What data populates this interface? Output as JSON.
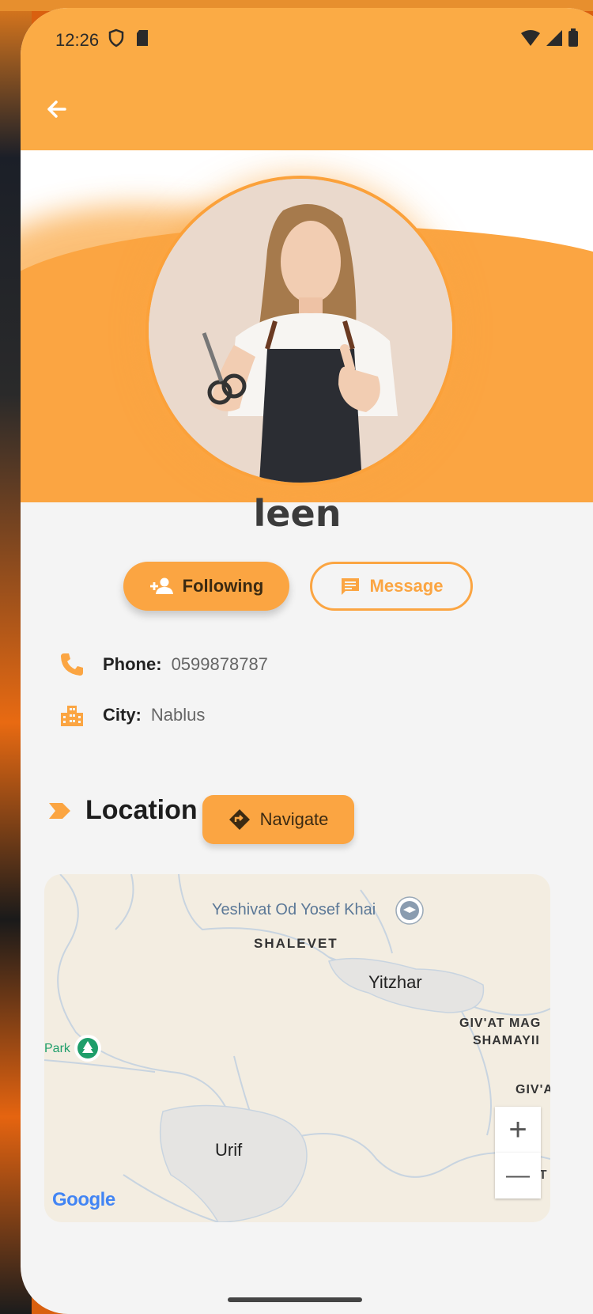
{
  "status_bar": {
    "time": "12:26"
  },
  "profile": {
    "name": "leen",
    "follow_label": "Following",
    "message_label": "Message",
    "phone_label": "Phone:",
    "phone_value": "0599878787",
    "city_label": "City:",
    "city_value": "Nablus"
  },
  "location": {
    "title": "Location",
    "navigate_label": "Navigate"
  },
  "map": {
    "labels": {
      "poi_school": "Yeshivat Od Yosef Khai",
      "shalevet": "SHALEVET",
      "yitzhar": "Yitzhar",
      "givat_1": "GIV'AT MAG",
      "givat_2": "SHAMAYII",
      "givat_3": "GIV'A",
      "park": "Park",
      "urif": "Urif",
      "mit": "MIT",
      "google": "Google"
    },
    "zoom_in": "+",
    "zoom_out": "—"
  },
  "colors": {
    "accent": "#fba542",
    "background": "#f4f4f4"
  },
  "icons": [
    "back-arrow-icon",
    "shield-icon",
    "sd-card-icon",
    "wifi-icon",
    "signal-icon",
    "battery-icon",
    "person-add-icon",
    "message-icon",
    "phone-icon",
    "city-icon",
    "chevron-marker-icon",
    "directions-icon",
    "school-pin-icon",
    "tree-pin-icon"
  ]
}
